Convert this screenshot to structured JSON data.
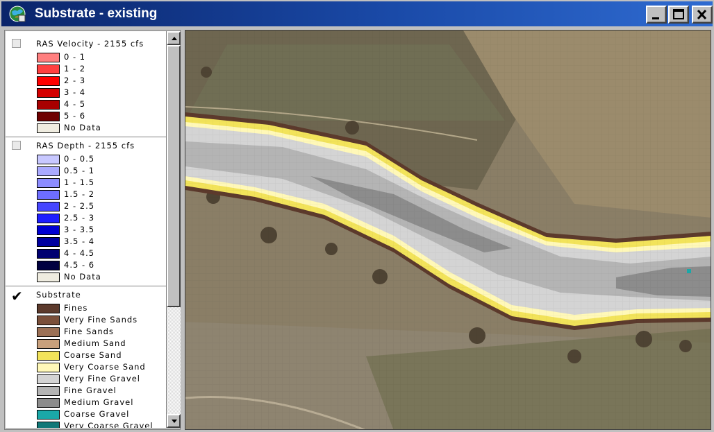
{
  "window": {
    "title": "Substrate - existing",
    "controls": [
      "minimize",
      "maximize",
      "close"
    ]
  },
  "legend": {
    "layers": [
      {
        "name": "RAS Velocity - 2155 cfs",
        "checked": false,
        "classes": [
          {
            "label": "0 - 1",
            "color": "#ff7f7f"
          },
          {
            "label": "1 - 2",
            "color": "#ff4040"
          },
          {
            "label": "2 - 3",
            "color": "#ff0000"
          },
          {
            "label": "3 - 4",
            "color": "#d40000"
          },
          {
            "label": "4 - 5",
            "color": "#a80000"
          },
          {
            "label": "5 - 6",
            "color": "#6e0000"
          },
          {
            "label": "No Data",
            "color": "#efece0"
          }
        ]
      },
      {
        "name": "RAS Depth - 2155 cfs",
        "checked": false,
        "classes": [
          {
            "label": "0 - 0.5",
            "color": "#c8c8ff"
          },
          {
            "label": "0.5 - 1",
            "color": "#aaaaff"
          },
          {
            "label": "1 - 1.5",
            "color": "#8c8cff"
          },
          {
            "label": "1.5 - 2",
            "color": "#6e6eff"
          },
          {
            "label": "2 - 2.5",
            "color": "#4646ff"
          },
          {
            "label": "2.5 - 3",
            "color": "#1e1eff"
          },
          {
            "label": "3 - 3.5",
            "color": "#0000d2"
          },
          {
            "label": "3.5 - 4",
            "color": "#0000a0"
          },
          {
            "label": "4 - 4.5",
            "color": "#000070"
          },
          {
            "label": "4.5 - 6",
            "color": "#000040"
          },
          {
            "label": "No Data",
            "color": "#efece0"
          }
        ]
      },
      {
        "name": "Substrate",
        "checked": true,
        "classes": [
          {
            "label": "Fines",
            "color": "#5c3a2c"
          },
          {
            "label": "Very Fine Sands",
            "color": "#7a4f3a"
          },
          {
            "label": "Fine Sands",
            "color": "#9c7055"
          },
          {
            "label": "Medium Sand",
            "color": "#c8a07c"
          },
          {
            "label": "Coarse Sand",
            "color": "#f2e35a"
          },
          {
            "label": "Very Coarse Sand",
            "color": "#fff8b8"
          },
          {
            "label": "Very Fine Gravel",
            "color": "#d4d4d4"
          },
          {
            "label": "Fine Gravel",
            "color": "#b4b4b4"
          },
          {
            "label": "Medium Gravel",
            "color": "#8c8c8c"
          },
          {
            "label": "Coarse Gravel",
            "color": "#1aa8a8"
          },
          {
            "label": "Very Coarse Gravel",
            "color": "#117878"
          }
        ]
      }
    ]
  },
  "colors": {
    "titlebar": "#0a246a",
    "terrain_light": "#9a8e7a",
    "terrain_dark": "#6e6148"
  },
  "map": {
    "icon": "aerial-imagery"
  }
}
